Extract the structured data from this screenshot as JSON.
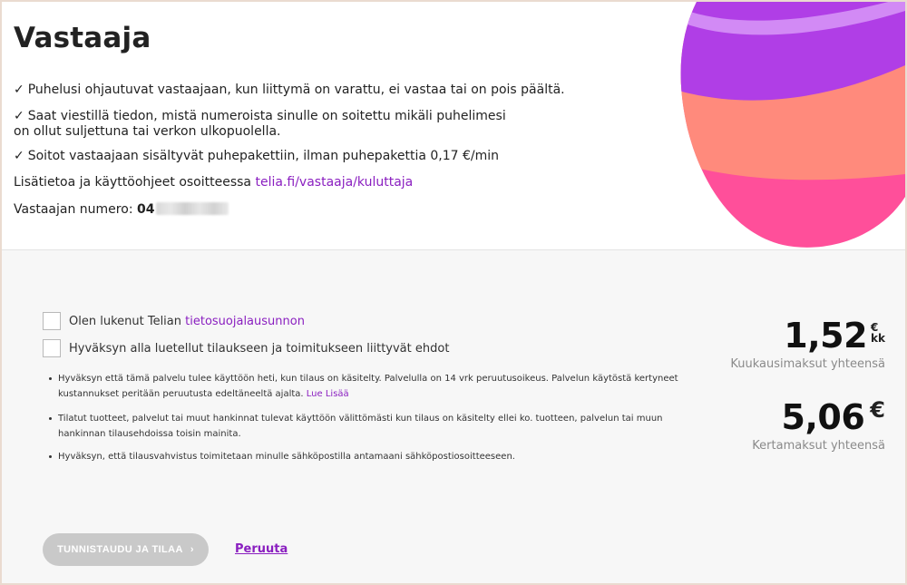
{
  "header": {
    "title": "Vastaaja"
  },
  "benefits": [
    "Puhelusi ohjautuvat vastaajaan, kun liittymä on varattu, ei vastaa tai on pois päältä.",
    "Saat viestillä tiedon, mistä numeroista sinulle on soitettu mikäli puhelimesi on ollut suljettuna tai verkon ulkopuolella.",
    "Soitot vastaajaan sisältyvät puhepakettiin, ilman puhepakettia 0,17 €/min"
  ],
  "info": {
    "text": "Lisätietoa ja käyttöohjeet osoitteessa",
    "link": "telia.fi/vastaaja/kuluttaja"
  },
  "voicemail_number": {
    "label": "Vastaajan numero:",
    "value": "04"
  },
  "consents": {
    "privacy_text": "Olen lukenut Telian",
    "privacy_link": "tietosuojalausunnon",
    "terms_text": "Hyväksyn alla luetellut tilaukseen ja toimitukseen liittyvät ehdot"
  },
  "terms": [
    {
      "text": "Hyväksyn että tämä palvelu tulee käyttöön heti, kun tilaus on käsitelty. Palvelulla on 14 vrk peruutusoikeus. Palvelun käytöstä kertyneet kustannukset peritään peruutusta edeltäneeltä ajalta.",
      "link": "Lue Lisää"
    },
    {
      "text": "Tilatut tuotteet, palvelut tai muut hankinnat tulevat käyttöön välittömästi kun tilaus on käsitelty ellei ko. tuotteen, palvelun tai muun hankinnan tilausehdoissa toisin mainita."
    },
    {
      "text": "Hyväksyn, että tilausvahvistus toimitetaan minulle sähköpostilla antamaani sähköpostiosoitteeseen."
    }
  ],
  "pricing": {
    "monthly": {
      "amount": "1,52",
      "currency": "€",
      "unit": "kk",
      "label": "Kuukausimaksut yhteensä"
    },
    "one_time": {
      "amount": "5,06",
      "currency": "€",
      "label": "Kertamaksut yhteensä"
    }
  },
  "actions": {
    "submit_label": "TUNNISTAUDU JA TILAA",
    "submit_chevron": "›",
    "cancel_label": "Peruuta"
  },
  "colors": {
    "accent": "#8a1fc0",
    "blob_purple": "#b03ee6",
    "blob_light_purple": "#d28af5",
    "blob_salmon": "#ff8a7c",
    "blob_pink": "#ff4f9a",
    "button_disabled": "#c9c9c9"
  }
}
